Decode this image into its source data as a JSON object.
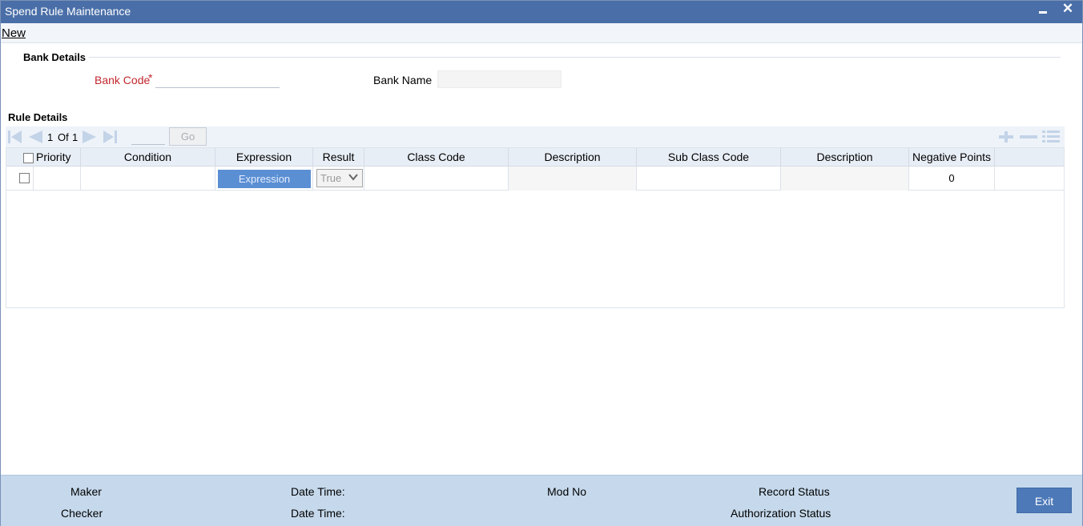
{
  "window": {
    "title": "Spend Rule Maintenance",
    "minimize_icon": "minimize-icon",
    "close_icon": "close-icon",
    "close_glyph": "✕"
  },
  "menu": {
    "new_label": "New"
  },
  "bank_details": {
    "section_label": "Bank Details",
    "bank_code_label": "Bank Code",
    "required_marker": "*",
    "bank_code_value": "",
    "bank_name_label": "Bank Name",
    "bank_name_value": ""
  },
  "rule_details": {
    "section_label": "Rule Details",
    "pagination": {
      "current": "1",
      "of_label": "Of",
      "total": "1",
      "goto_value": "",
      "go_label": "Go"
    },
    "columns": [
      "Priority",
      "Condition",
      "Expression",
      "Result",
      "Class Code",
      "Description",
      "Sub Class Code",
      "Description",
      "Negative Points"
    ],
    "rows": [
      {
        "priority": "",
        "condition": "",
        "expression_button": "Expression",
        "result": "True",
        "class_code": "",
        "class_description": "",
        "sub_class_code": "",
        "sub_class_description": "",
        "negative_points": "0"
      }
    ]
  },
  "footer": {
    "maker_label": "Maker",
    "checker_label": "Checker",
    "date_time_label_1": "Date Time:",
    "date_time_label_2": "Date Time:",
    "mod_no_label": "Mod No",
    "record_status_label": "Record Status",
    "authorization_status_label": "Authorization Status",
    "exit_label": "Exit"
  },
  "colors": {
    "title_bar": "#4a6fa8",
    "required_label": "#c0272d",
    "footer_bg": "#c6d9ec",
    "exit_button": "#4d79b8",
    "expression_button": "#5b8fd4"
  }
}
